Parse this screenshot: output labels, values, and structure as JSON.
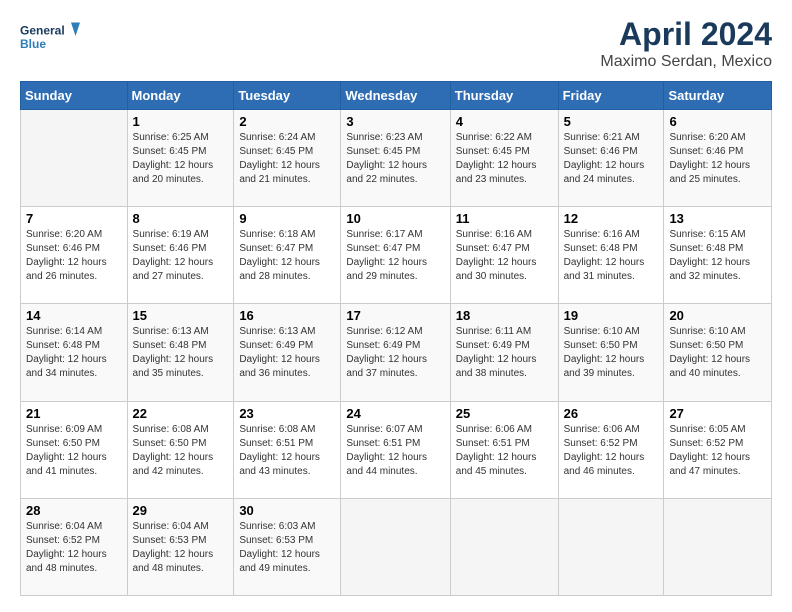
{
  "header": {
    "logo_line1": "General",
    "logo_line2": "Blue",
    "title": "April 2024",
    "subtitle": "Maximo Serdan, Mexico"
  },
  "days_of_week": [
    "Sunday",
    "Monday",
    "Tuesday",
    "Wednesday",
    "Thursday",
    "Friday",
    "Saturday"
  ],
  "weeks": [
    [
      {
        "day": "",
        "info": ""
      },
      {
        "day": "1",
        "info": "Sunrise: 6:25 AM\nSunset: 6:45 PM\nDaylight: 12 hours\nand 20 minutes."
      },
      {
        "day": "2",
        "info": "Sunrise: 6:24 AM\nSunset: 6:45 PM\nDaylight: 12 hours\nand 21 minutes."
      },
      {
        "day": "3",
        "info": "Sunrise: 6:23 AM\nSunset: 6:45 PM\nDaylight: 12 hours\nand 22 minutes."
      },
      {
        "day": "4",
        "info": "Sunrise: 6:22 AM\nSunset: 6:45 PM\nDaylight: 12 hours\nand 23 minutes."
      },
      {
        "day": "5",
        "info": "Sunrise: 6:21 AM\nSunset: 6:46 PM\nDaylight: 12 hours\nand 24 minutes."
      },
      {
        "day": "6",
        "info": "Sunrise: 6:20 AM\nSunset: 6:46 PM\nDaylight: 12 hours\nand 25 minutes."
      }
    ],
    [
      {
        "day": "7",
        "info": "Sunrise: 6:20 AM\nSunset: 6:46 PM\nDaylight: 12 hours\nand 26 minutes."
      },
      {
        "day": "8",
        "info": "Sunrise: 6:19 AM\nSunset: 6:46 PM\nDaylight: 12 hours\nand 27 minutes."
      },
      {
        "day": "9",
        "info": "Sunrise: 6:18 AM\nSunset: 6:47 PM\nDaylight: 12 hours\nand 28 minutes."
      },
      {
        "day": "10",
        "info": "Sunrise: 6:17 AM\nSunset: 6:47 PM\nDaylight: 12 hours\nand 29 minutes."
      },
      {
        "day": "11",
        "info": "Sunrise: 6:16 AM\nSunset: 6:47 PM\nDaylight: 12 hours\nand 30 minutes."
      },
      {
        "day": "12",
        "info": "Sunrise: 6:16 AM\nSunset: 6:48 PM\nDaylight: 12 hours\nand 31 minutes."
      },
      {
        "day": "13",
        "info": "Sunrise: 6:15 AM\nSunset: 6:48 PM\nDaylight: 12 hours\nand 32 minutes."
      }
    ],
    [
      {
        "day": "14",
        "info": "Sunrise: 6:14 AM\nSunset: 6:48 PM\nDaylight: 12 hours\nand 34 minutes."
      },
      {
        "day": "15",
        "info": "Sunrise: 6:13 AM\nSunset: 6:48 PM\nDaylight: 12 hours\nand 35 minutes."
      },
      {
        "day": "16",
        "info": "Sunrise: 6:13 AM\nSunset: 6:49 PM\nDaylight: 12 hours\nand 36 minutes."
      },
      {
        "day": "17",
        "info": "Sunrise: 6:12 AM\nSunset: 6:49 PM\nDaylight: 12 hours\nand 37 minutes."
      },
      {
        "day": "18",
        "info": "Sunrise: 6:11 AM\nSunset: 6:49 PM\nDaylight: 12 hours\nand 38 minutes."
      },
      {
        "day": "19",
        "info": "Sunrise: 6:10 AM\nSunset: 6:50 PM\nDaylight: 12 hours\nand 39 minutes."
      },
      {
        "day": "20",
        "info": "Sunrise: 6:10 AM\nSunset: 6:50 PM\nDaylight: 12 hours\nand 40 minutes."
      }
    ],
    [
      {
        "day": "21",
        "info": "Sunrise: 6:09 AM\nSunset: 6:50 PM\nDaylight: 12 hours\nand 41 minutes."
      },
      {
        "day": "22",
        "info": "Sunrise: 6:08 AM\nSunset: 6:50 PM\nDaylight: 12 hours\nand 42 minutes."
      },
      {
        "day": "23",
        "info": "Sunrise: 6:08 AM\nSunset: 6:51 PM\nDaylight: 12 hours\nand 43 minutes."
      },
      {
        "day": "24",
        "info": "Sunrise: 6:07 AM\nSunset: 6:51 PM\nDaylight: 12 hours\nand 44 minutes."
      },
      {
        "day": "25",
        "info": "Sunrise: 6:06 AM\nSunset: 6:51 PM\nDaylight: 12 hours\nand 45 minutes."
      },
      {
        "day": "26",
        "info": "Sunrise: 6:06 AM\nSunset: 6:52 PM\nDaylight: 12 hours\nand 46 minutes."
      },
      {
        "day": "27",
        "info": "Sunrise: 6:05 AM\nSunset: 6:52 PM\nDaylight: 12 hours\nand 47 minutes."
      }
    ],
    [
      {
        "day": "28",
        "info": "Sunrise: 6:04 AM\nSunset: 6:52 PM\nDaylight: 12 hours\nand 48 minutes."
      },
      {
        "day": "29",
        "info": "Sunrise: 6:04 AM\nSunset: 6:53 PM\nDaylight: 12 hours\nand 48 minutes."
      },
      {
        "day": "30",
        "info": "Sunrise: 6:03 AM\nSunset: 6:53 PM\nDaylight: 12 hours\nand 49 minutes."
      },
      {
        "day": "",
        "info": ""
      },
      {
        "day": "",
        "info": ""
      },
      {
        "day": "",
        "info": ""
      },
      {
        "day": "",
        "info": ""
      }
    ]
  ]
}
